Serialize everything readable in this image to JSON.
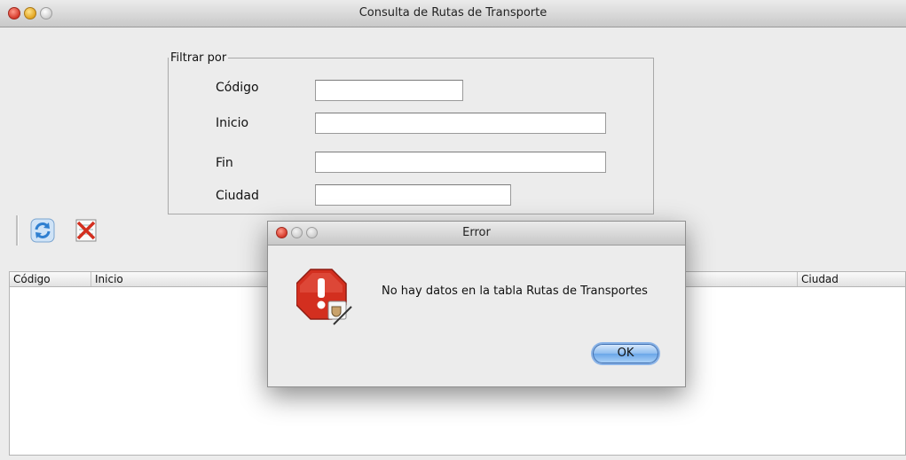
{
  "window": {
    "title": "Consulta de Rutas de Transporte"
  },
  "filter": {
    "legend": "Filtrar por",
    "fields": [
      {
        "label": "Código",
        "value": ""
      },
      {
        "label": "Inicio",
        "value": ""
      },
      {
        "label": "Fin",
        "value": ""
      },
      {
        "label": "Ciudad",
        "value": ""
      }
    ]
  },
  "toolbar": {
    "icons": [
      "refresh-icon",
      "clear-icon"
    ]
  },
  "table": {
    "columns": [
      "Código",
      "Inicio",
      "Ciudad"
    ],
    "rows": []
  },
  "dialog": {
    "title": "Error",
    "message": "No hay datos en la tabla Rutas de Transportes",
    "ok_label": "OK",
    "icon": "stop-icon"
  },
  "colors": {
    "accent": "#6aa6e8",
    "error": "#d32f1f"
  }
}
